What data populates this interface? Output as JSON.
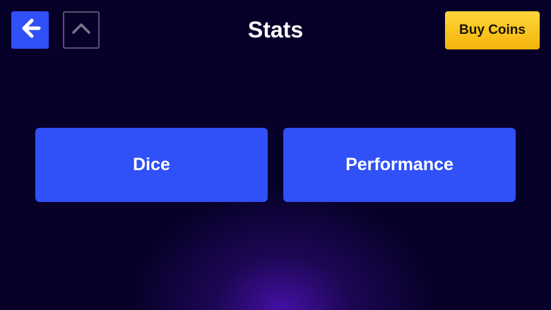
{
  "header": {
    "title": "Stats",
    "back_icon": "arrow-left-icon",
    "up_icon": "chevron-up-icon",
    "buy_coins_label": "Buy Coins"
  },
  "menu": {
    "items": [
      {
        "label": "Dice"
      },
      {
        "label": "Performance"
      }
    ]
  },
  "colors": {
    "background": "#07012a",
    "primary_button": "#3050f8",
    "coins_button": "#f9c51f",
    "glow": "#4b12b2"
  }
}
